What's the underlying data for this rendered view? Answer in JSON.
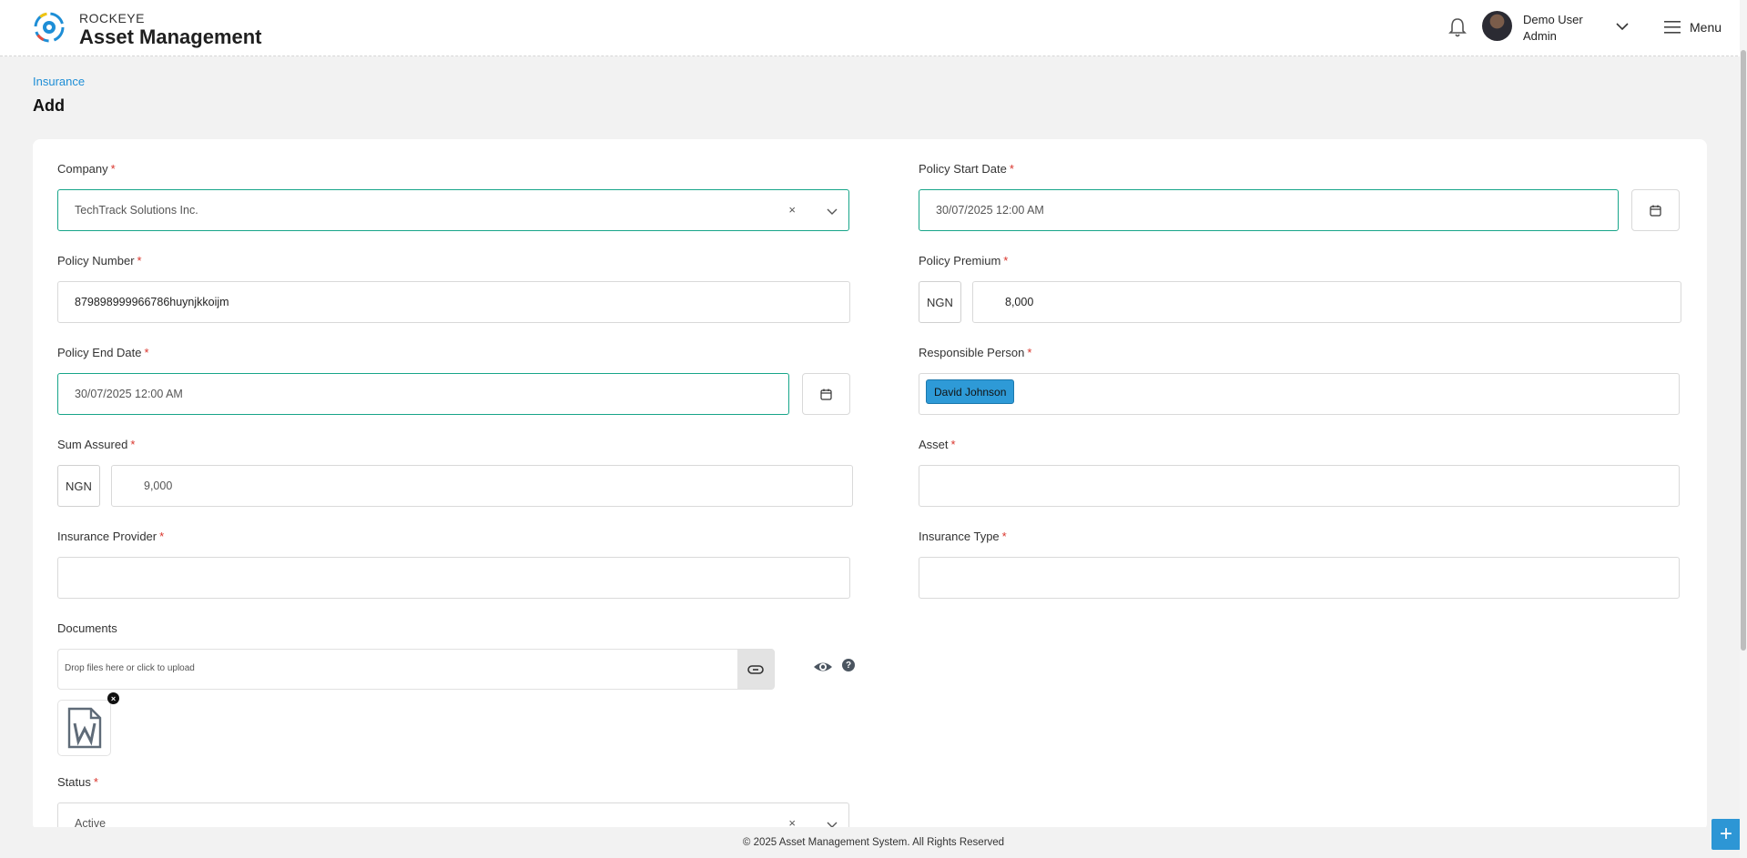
{
  "header": {
    "brand_small": "ROCKEYE",
    "brand_title": "Asset Management",
    "user_name": "Demo User",
    "user_role": "Admin",
    "menu_label": "Menu"
  },
  "page": {
    "breadcrumb": "Insurance",
    "title": "Add"
  },
  "form": {
    "company": {
      "label": "Company",
      "value": "TechTrack Solutions Inc."
    },
    "policy_start_date": {
      "label": "Policy Start Date",
      "value": "30/07/2025 12:00 AM"
    },
    "policy_number": {
      "label": "Policy Number",
      "value": "879898999966786huynjkkoijm"
    },
    "policy_premium": {
      "label": "Policy Premium",
      "currency": "NGN",
      "value": "8,000"
    },
    "policy_end_date": {
      "label": "Policy End Date",
      "value": "30/07/2025 12:00 AM"
    },
    "responsible_person": {
      "label": "Responsible Person",
      "value": "David Johnson"
    },
    "sum_assured": {
      "label": "Sum Assured",
      "currency": "NGN",
      "value": "9,000"
    },
    "asset": {
      "label": "Asset",
      "value": ""
    },
    "insurance_provider": {
      "label": "Insurance Provider",
      "value": ""
    },
    "insurance_type": {
      "label": "Insurance Type",
      "value": ""
    },
    "documents": {
      "label": "Documents",
      "placeholder": "Drop files here or click to upload",
      "help": "?"
    },
    "status": {
      "label": "Status",
      "value": "Active"
    },
    "required_mark": "*",
    "clear_symbol": "×"
  },
  "footer": {
    "text": "© 2025 Asset Management System. All Rights Reserved"
  },
  "fab_label": "+",
  "icons": {
    "logo": "gear-logo-icon",
    "notification": "bell-icon",
    "menu": "hamburger-icon",
    "calendar": "calendar-icon",
    "attach": "paperclip-icon",
    "preview": "eye-icon",
    "document": "word-document-icon"
  },
  "colors": {
    "accent": "#17a589",
    "link": "#1e8ed6",
    "tag": "#2e9ad7",
    "required": "#d9342b"
  }
}
